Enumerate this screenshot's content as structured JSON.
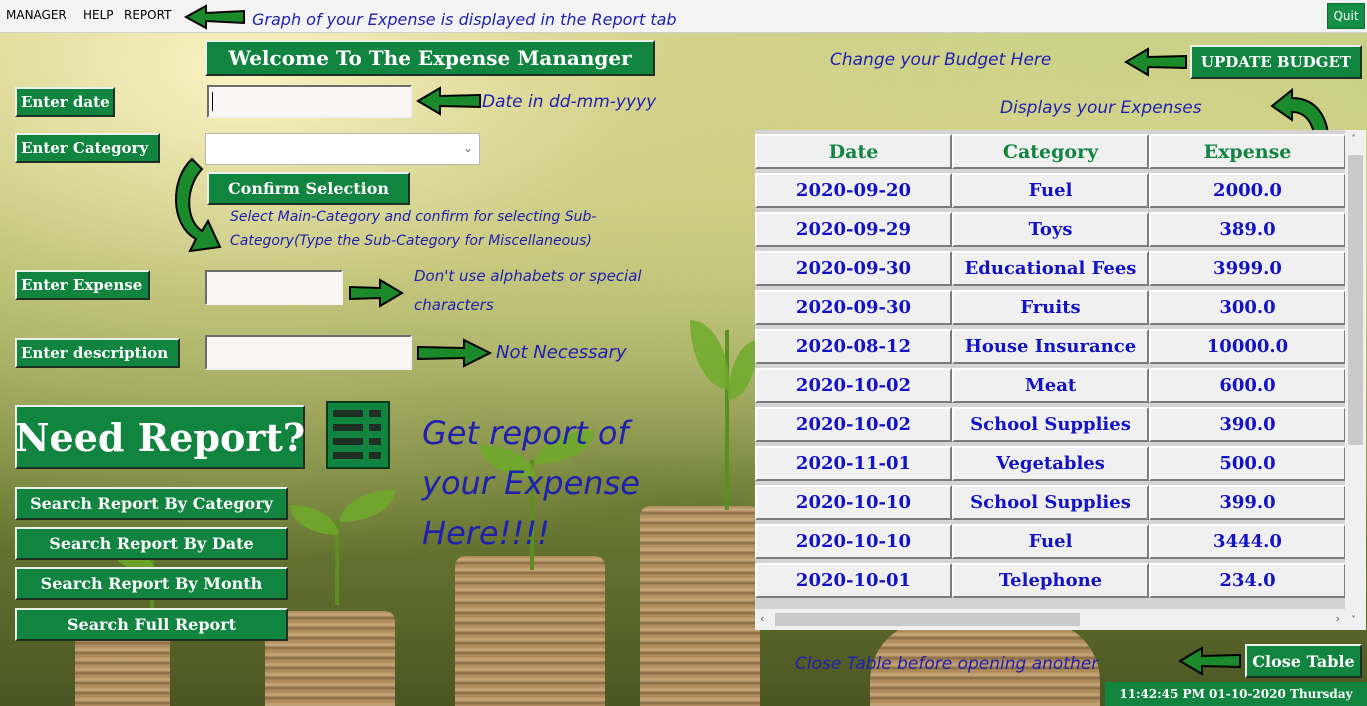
{
  "menu": {
    "items": [
      "MANAGER",
      "HELP",
      "REPORT"
    ],
    "quit": "Quit"
  },
  "header": {
    "title": "Welcome To The Expense Mananger"
  },
  "form": {
    "date_label": "Enter date",
    "category_label": "Enter Category",
    "confirm_button": "Confirm Selection",
    "expense_label": "Enter Expense",
    "description_label": "Enter description",
    "date_value": "",
    "category_value": "",
    "expense_value": "",
    "description_value": ""
  },
  "report": {
    "heading": "Need Report?",
    "icon": "report-list-icon",
    "buttons": [
      "Search Report By Category",
      "Search Report By Date",
      "Search Report By Month",
      "Search Full Report"
    ]
  },
  "budget": {
    "update_button": "UPDATE BUDGET"
  },
  "table": {
    "columns": [
      "Date",
      "Category",
      "Expense"
    ],
    "rows": [
      [
        "2020-09-20",
        "Fuel",
        "2000.0"
      ],
      [
        "2020-09-29",
        "Toys",
        "389.0"
      ],
      [
        "2020-09-30",
        "Educational Fees",
        "3999.0"
      ],
      [
        "2020-09-30",
        "Fruits",
        "300.0"
      ],
      [
        "2020-08-12",
        "House Insurance",
        "10000.0"
      ],
      [
        "2020-10-02",
        "Meat",
        "600.0"
      ],
      [
        "2020-10-02",
        "School Supplies",
        "390.0"
      ],
      [
        "2020-11-01",
        "Vegetables",
        "500.0"
      ],
      [
        "2020-10-10",
        "School Supplies",
        "399.0"
      ],
      [
        "2020-10-10",
        "Fuel",
        "3444.0"
      ],
      [
        "2020-10-01",
        "Telephone",
        "234.0"
      ]
    ],
    "close_button": "Close Table"
  },
  "status": {
    "clock": "11:42:45 PM 01-10-2020 Thursday"
  },
  "annotations": {
    "report_tab": "Graph of your Expense is displayed in the Report tab",
    "budget": "Change your Budget Here",
    "table": "Displays your Expenses",
    "date": "Date in dd-mm-yyyy",
    "category_line1": "Select Main-Category and confirm for selecting Sub-",
    "category_line2": "Category(Type the Sub-Category for Miscellaneous)",
    "expense_line1": "Don't use alphabets or special",
    "expense_line2": "characters",
    "description": "Not Necessary",
    "report_line1": "Get report of",
    "report_line2": "your Expense",
    "report_line3": "Here!!!!",
    "close": "Close Table before opening another"
  },
  "colors": {
    "accent_green": "#11843f",
    "annotation_blue": "#1f1fb0",
    "cell_text": "#1212c8"
  }
}
